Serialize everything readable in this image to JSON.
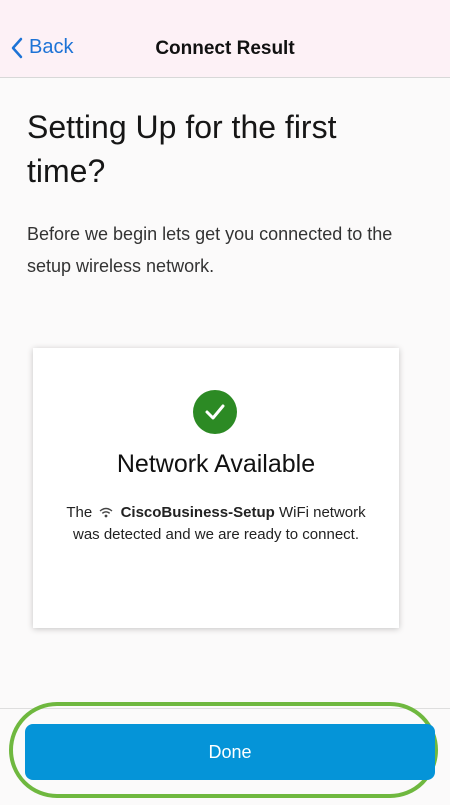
{
  "navbar": {
    "back_label": "Back",
    "title": "Connect Result"
  },
  "main": {
    "headline": "Setting Up for the first time?",
    "intro": "Before we begin lets get you connected to the setup wireless network."
  },
  "card": {
    "title": "Network Available",
    "desc_prefix": "The",
    "network_name": "CiscoBusiness-Setup",
    "desc_suffix": "WiFi network was detected and we are ready to connect.",
    "status_icon": "check-icon"
  },
  "actions": {
    "done_label": "Done"
  },
  "colors": {
    "accent": "#0594d8",
    "link": "#1d73d6",
    "success": "#2c8a24",
    "highlight": "#6fb83f"
  }
}
